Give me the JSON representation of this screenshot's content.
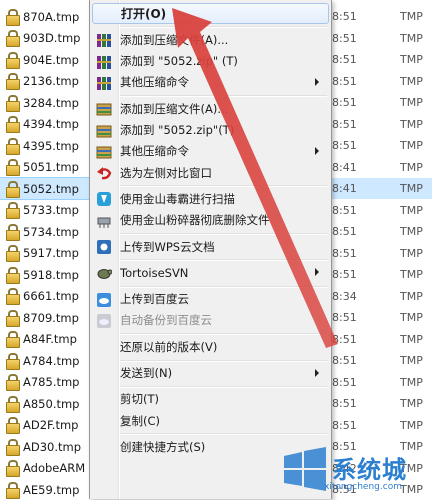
{
  "files": [
    {
      "name": "870A.tmp",
      "time": "8:51",
      "type": "TMP"
    },
    {
      "name": "903D.tmp",
      "time": "8:51",
      "type": "TMP"
    },
    {
      "name": "904E.tmp",
      "time": "8:51",
      "type": "TMP"
    },
    {
      "name": "2136.tmp",
      "time": "8:51",
      "type": "TMP"
    },
    {
      "name": "3284.tmp",
      "time": "8:51",
      "type": "TMP"
    },
    {
      "name": "4394.tmp",
      "time": "8:51",
      "type": "TMP"
    },
    {
      "name": "4395.tmp",
      "time": "8:51",
      "type": "TMP"
    },
    {
      "name": "5051.tmp",
      "time": "8:41",
      "type": "TMP"
    },
    {
      "name": "5052.tmp",
      "time": "8:41",
      "type": "TMP",
      "selected": true
    },
    {
      "name": "5733.tmp",
      "time": "8:51",
      "type": "TMP"
    },
    {
      "name": "5734.tmp",
      "time": "8:51",
      "type": "TMP"
    },
    {
      "name": "5917.tmp",
      "time": "8:51",
      "type": "TMP"
    },
    {
      "name": "5918.tmp",
      "time": "8:51",
      "type": "TMP"
    },
    {
      "name": "6661.tmp",
      "time": "8:34",
      "type": "TMP"
    },
    {
      "name": "8709.tmp",
      "time": "8:51",
      "type": "TMP"
    },
    {
      "name": "A84F.tmp",
      "time": "8:51",
      "type": "TMP"
    },
    {
      "name": "A784.tmp",
      "time": "8:51",
      "type": "TMP"
    },
    {
      "name": "A785.tmp",
      "time": "8:51",
      "type": "TMP"
    },
    {
      "name": "A850.tmp",
      "time": "8:51",
      "type": "TMP"
    },
    {
      "name": "AD2F.tmp",
      "time": "8:51",
      "type": "TMP"
    },
    {
      "name": "AD30.tmp",
      "time": "8:51",
      "type": "TMP"
    },
    {
      "name": "AdobeARM",
      "time": "8:42",
      "type": "TMP"
    },
    {
      "name": "AE59.tmp",
      "time": "8:51",
      "type": "TMP"
    }
  ],
  "menu": {
    "items": [
      {
        "label": "打开(O)",
        "icon": "none",
        "bold": true,
        "highlight": true
      },
      {
        "sep": true
      },
      {
        "label": "添加到压缩文件(A)...",
        "icon": "winrar-books-icon"
      },
      {
        "label": "添加到 \"5052.zip\" (T)",
        "icon": "winrar-books-icon"
      },
      {
        "label": "其他压缩命令",
        "icon": "winrar-books-icon",
        "submenu": true
      },
      {
        "sep": true
      },
      {
        "label": "添加到压缩文件(A)...",
        "icon": "zip-archive-icon"
      },
      {
        "label": "添加到 \"5052.zip\"(T)",
        "icon": "zip-archive-icon"
      },
      {
        "label": "其他压缩命令",
        "icon": "zip-archive-icon",
        "submenu": true
      },
      {
        "label": "选为左侧对比窗口",
        "icon": "undo-arrow-icon"
      },
      {
        "sep": true
      },
      {
        "label": "使用金山毒霸进行扫描",
        "icon": "kingsoft-antivirus-icon"
      },
      {
        "label": "使用金山粉碎器彻底删除文件",
        "icon": "shredder-icon"
      },
      {
        "sep": true
      },
      {
        "label": "上传到WPS云文档",
        "icon": "wps-cloud-icon"
      },
      {
        "sep": true
      },
      {
        "label": "TortoiseSVN",
        "icon": "tortoise-svn-icon",
        "submenu": true
      },
      {
        "sep": true
      },
      {
        "label": "上传到百度云",
        "icon": "baidu-cloud-icon"
      },
      {
        "label": "自动备份到百度云",
        "icon": "baidu-backup-icon",
        "disabled": true
      },
      {
        "sep": true
      },
      {
        "label": "还原以前的版本(V)",
        "icon": "none"
      },
      {
        "sep": true
      },
      {
        "label": "发送到(N)",
        "icon": "none",
        "submenu": true
      },
      {
        "sep": true
      },
      {
        "label": "剪切(T)",
        "icon": "none"
      },
      {
        "label": "复制(C)",
        "icon": "none"
      },
      {
        "sep": true
      },
      {
        "label": "创建快捷方式(S)",
        "icon": "none"
      }
    ]
  },
  "watermark": {
    "text": "系统城",
    "url": "xitongcheng.com"
  },
  "colors": {
    "arrow": "#d9413c",
    "selection": "#cde8ff",
    "menu_bg": "#f0f0f0",
    "watermark": "#2d7fd0"
  }
}
